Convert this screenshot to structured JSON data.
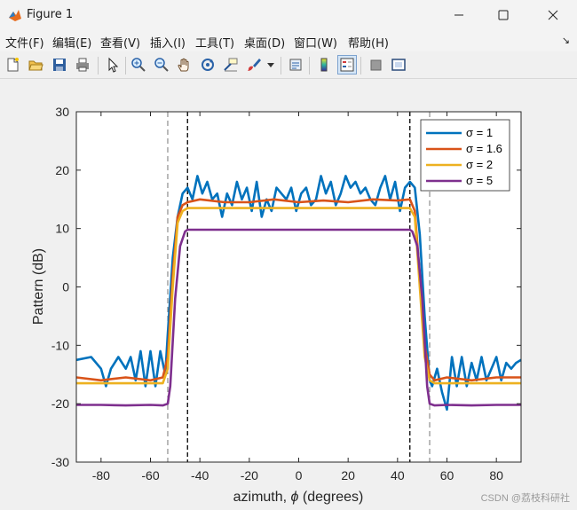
{
  "window": {
    "title": "Figure 1",
    "minimize_icon": "minimize-icon",
    "maximize_icon": "maximize-icon",
    "close_icon": "close-icon"
  },
  "menu": {
    "items": [
      "文件(F)",
      "编辑(E)",
      "查看(V)",
      "插入(I)",
      "工具(T)",
      "桌面(D)",
      "窗口(W)",
      "帮助(H)"
    ],
    "overflow_glyph": "↘"
  },
  "toolbar": {
    "icons": [
      "new-figure-icon",
      "open-file-icon",
      "save-icon",
      "print-icon",
      "pointer-icon",
      "zoom-in-icon",
      "zoom-out-icon",
      "pan-hand-icon",
      "rotate-3d-icon",
      "data-cursor-icon",
      "brush-icon",
      "brush-dropdown-icon",
      "link-plot-icon",
      "colorbar-icon",
      "legend-icon",
      "hide-plot-tools-icon",
      "show-plot-tools-icon"
    ],
    "active": "legend-icon"
  },
  "chart_data": {
    "type": "line",
    "title": "",
    "xlabel": "azimuth, φ (degrees)",
    "xlabel_parts": [
      "azimuth, ",
      "ϕ",
      " (degrees)"
    ],
    "ylabel": "Pattern (dB)",
    "xlim": [
      -90,
      90
    ],
    "ylim": [
      -30,
      30
    ],
    "xticks": [
      -80,
      -60,
      -40,
      -20,
      0,
      20,
      40,
      60,
      80
    ],
    "yticks": [
      -30,
      -20,
      -10,
      0,
      10,
      20,
      30
    ],
    "grid": false,
    "legend_position": "top-right",
    "vlines": [
      {
        "x": -53,
        "style": "dashed-thin"
      },
      {
        "x": -45,
        "style": "dashed"
      },
      {
        "x": 45,
        "style": "dashed"
      },
      {
        "x": 53,
        "style": "dashed-thin"
      }
    ],
    "series": [
      {
        "name": "σ = 1",
        "color": "#0072bd",
        "x": [
          -90,
          -84,
          -80,
          -78,
          -76,
          -73,
          -70,
          -68,
          -66,
          -64,
          -62,
          -60,
          -58,
          -56,
          -54,
          -53,
          -51,
          -49,
          -47,
          -45,
          -43,
          -41,
          -39,
          -37,
          -35,
          -33,
          -31,
          -29,
          -27,
          -25,
          -23,
          -21,
          -19,
          -17,
          -15,
          -13,
          -11,
          -9,
          -7,
          -5,
          -3,
          -1,
          1,
          3,
          5,
          7,
          9,
          11,
          13,
          15,
          17,
          19,
          21,
          23,
          25,
          27,
          29,
          31,
          33,
          35,
          37,
          39,
          41,
          43,
          45,
          47,
          49,
          51,
          53,
          54,
          56,
          58,
          60,
          62,
          64,
          66,
          68,
          70,
          72,
          74,
          76,
          78,
          80,
          82,
          84,
          86,
          88,
          90
        ],
        "y": [
          -12.5,
          -12,
          -14,
          -17,
          -14,
          -12,
          -14,
          -12,
          -16,
          -11,
          -17,
          -11,
          -17,
          -11,
          -15,
          -8,
          5,
          12,
          16,
          17,
          15,
          19,
          16,
          18,
          15,
          16,
          12,
          16,
          14,
          18,
          15,
          17,
          13,
          18,
          12,
          15,
          13,
          17,
          16,
          15,
          17,
          13,
          16,
          17,
          14,
          15,
          19,
          16,
          18,
          14,
          16,
          19,
          17,
          18,
          16,
          17,
          15,
          14,
          17,
          19,
          15,
          18,
          13,
          17,
          18,
          17,
          9,
          -5,
          -16,
          -17,
          -14,
          -18,
          -21,
          -12,
          -17,
          -12,
          -17,
          -13,
          -16,
          -12,
          -16,
          -14,
          -12,
          -16,
          -13,
          -14,
          -13,
          -12.5
        ]
      },
      {
        "name": "σ = 1.6",
        "color": "#d95319",
        "x": [
          -90,
          -80,
          -70,
          -60,
          -55,
          -53,
          -51,
          -49,
          -47,
          -45,
          -40,
          -30,
          -20,
          -10,
          0,
          10,
          20,
          30,
          40,
          45,
          47,
          49,
          51,
          53,
          55,
          60,
          70,
          80,
          90
        ],
        "y": [
          -15.5,
          -16,
          -15.5,
          -16,
          -15.5,
          -12,
          2,
          12,
          14,
          14.5,
          15,
          14.5,
          14.5,
          15,
          14.5,
          14.8,
          14.5,
          15,
          14.8,
          15,
          13,
          2,
          -10,
          -15,
          -16,
          -15.5,
          -16,
          -15.5,
          -15.5
        ]
      },
      {
        "name": "σ = 2",
        "color": "#edb120",
        "x": [
          -90,
          -80,
          -70,
          -60,
          -55,
          -53,
          -51,
          -49,
          -47,
          -45,
          -40,
          -30,
          -20,
          -10,
          0,
          10,
          20,
          30,
          40,
          45,
          47,
          49,
          51,
          53,
          55,
          60,
          70,
          80,
          90
        ],
        "y": [
          -16.5,
          -16.5,
          -16.5,
          -16.5,
          -16.5,
          -14,
          0,
          11,
          13,
          13.5,
          13.5,
          13.5,
          13.5,
          13.5,
          13.5,
          13.5,
          13.5,
          13.5,
          13.5,
          13.5,
          12,
          0,
          -12,
          -16,
          -16.5,
          -16.5,
          -16.5,
          -16.5,
          -16.5
        ]
      },
      {
        "name": "σ = 5",
        "color": "#7e2f8e",
        "x": [
          -90,
          -80,
          -70,
          -60,
          -55,
          -53,
          -52,
          -50,
          -48,
          -46,
          -45,
          -40,
          -30,
          -20,
          -10,
          0,
          10,
          20,
          30,
          40,
          45,
          46,
          48,
          50,
          52,
          53,
          55,
          60,
          70,
          80,
          90
        ],
        "y": [
          -20.2,
          -20.2,
          -20.3,
          -20.2,
          -20.3,
          -20,
          -17,
          -2,
          7,
          9.5,
          9.8,
          9.8,
          9.8,
          9.8,
          9.8,
          9.8,
          9.8,
          9.8,
          9.8,
          9.8,
          9.8,
          9.5,
          7,
          -2,
          -17,
          -20,
          -20.3,
          -20.2,
          -20.3,
          -20.2,
          -20.2
        ]
      }
    ]
  },
  "watermark": "CSDN @荔枝科研社"
}
